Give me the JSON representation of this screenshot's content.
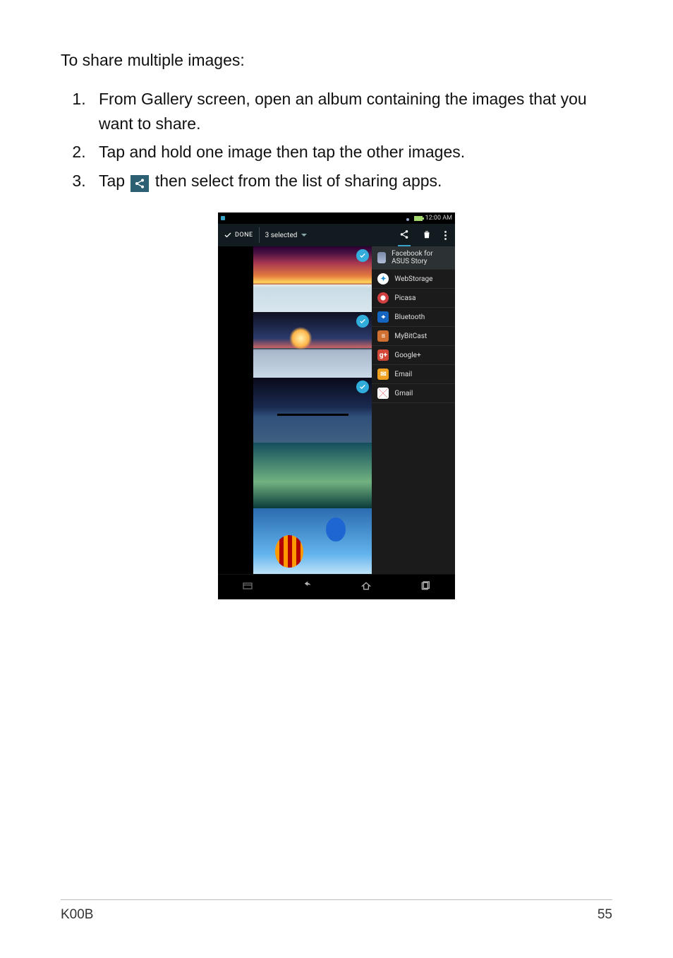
{
  "heading": "To share multiple images:",
  "steps": {
    "s1": "From Gallery screen, open an album containing the images that you want to share.",
    "s2": "Tap and hold one image then tap the other images.",
    "s3_pre": "Tap",
    "s3_post": "then select from the list of sharing apps."
  },
  "footer": {
    "left": "K00B",
    "right": "55"
  },
  "device": {
    "status_time": "12:00 AM",
    "done_label": "DONE",
    "selected_label": "3 selected",
    "share_apps": [
      "Facebook for ASUS Story",
      "WebStorage",
      "Picasa",
      "Bluetooth",
      "MyBitCast",
      "Google+",
      "Email",
      "Gmail"
    ]
  }
}
